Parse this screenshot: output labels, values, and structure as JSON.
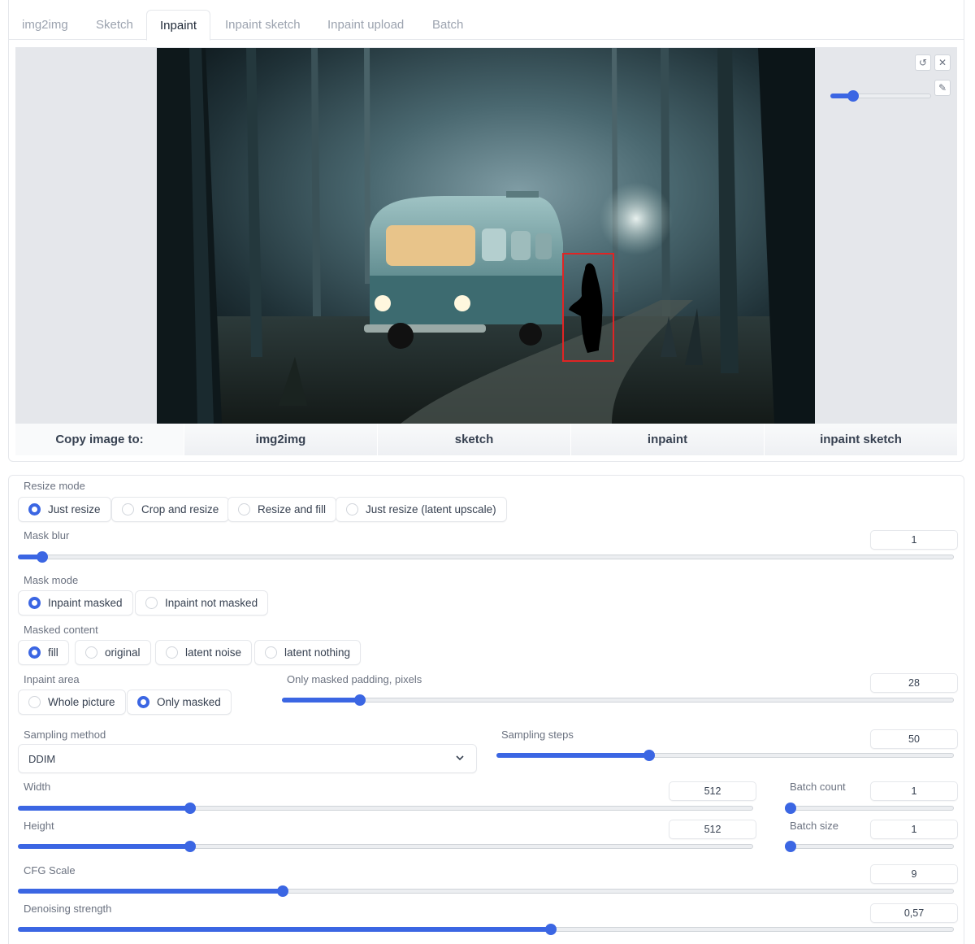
{
  "tabs": [
    {
      "label": "img2img"
    },
    {
      "label": "Sketch"
    },
    {
      "label": "Inpaint",
      "active": true
    },
    {
      "label": "Inpaint sketch"
    },
    {
      "label": "Inpaint upload"
    },
    {
      "label": "Batch"
    }
  ],
  "canvas": {
    "tools": [
      "undo-icon",
      "close-icon",
      "brush-icon"
    ],
    "brush_size_fraction": 0.19
  },
  "copy_image": {
    "label": "Copy image to:",
    "buttons": [
      "img2img",
      "sketch",
      "inpaint",
      "inpaint sketch"
    ]
  },
  "resize_mode": {
    "label": "Resize mode",
    "options": [
      "Just resize",
      "Crop and resize",
      "Resize and fill",
      "Just resize (latent upscale)"
    ],
    "selected": "Just resize"
  },
  "mask_blur": {
    "label": "Mask blur",
    "value": "1",
    "fraction": 0.02
  },
  "mask_mode": {
    "label": "Mask mode",
    "options": [
      "Inpaint masked",
      "Inpaint not masked"
    ],
    "selected": "Inpaint masked"
  },
  "masked_content": {
    "label": "Masked content",
    "options": [
      "fill",
      "original",
      "latent noise",
      "latent nothing"
    ],
    "selected": "fill"
  },
  "inpaint_area": {
    "label": "Inpaint area",
    "options": [
      "Whole picture",
      "Only masked"
    ],
    "selected": "Only masked"
  },
  "only_masked_padding": {
    "label": "Only masked padding, pixels",
    "value": "28",
    "fraction": 0.11
  },
  "sampling_method": {
    "label": "Sampling method",
    "value": "DDIM"
  },
  "sampling_steps": {
    "label": "Sampling steps",
    "value": "50",
    "fraction": 0.33
  },
  "width": {
    "label": "Width",
    "value": "512",
    "fraction": 0.23
  },
  "height": {
    "label": "Height",
    "value": "512",
    "fraction": 0.23
  },
  "batch_count": {
    "label": "Batch count",
    "value": "1",
    "fraction": 0.0
  },
  "batch_size": {
    "label": "Batch size",
    "value": "1",
    "fraction": 0.0
  },
  "cfg_scale": {
    "label": "CFG Scale",
    "value": "9",
    "fraction": 0.28
  },
  "denoising_strength": {
    "label": "Denoising strength",
    "value": "0,57",
    "fraction": 0.57
  },
  "colors": {
    "accent": "#3b66e3",
    "mask_box": "#e02424"
  }
}
